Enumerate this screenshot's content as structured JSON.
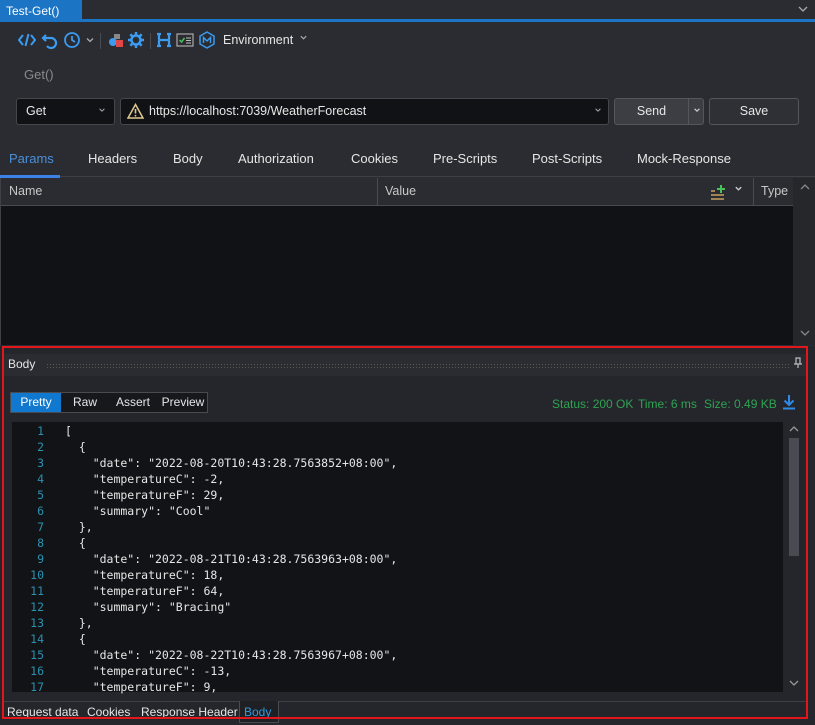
{
  "document_tab": {
    "title": "Test-Get()",
    "close_icon": "close-icon"
  },
  "toolbar": {
    "icons": [
      "code-icon",
      "undo-icon",
      "history-icon",
      "chevron-down-icon",
      "plugin-icon",
      "gear-icon",
      "header-icon",
      "checklist-icon",
      "mock-icon"
    ],
    "environment_label": "Environment"
  },
  "request": {
    "name": "Get()",
    "method": "Get",
    "url": "https://localhost:7039/WeatherForecast",
    "send_label": "Send",
    "save_label": "Save"
  },
  "request_tabs": [
    {
      "label": "Params",
      "active": true
    },
    {
      "label": "Headers"
    },
    {
      "label": "Body"
    },
    {
      "label": "Authorization"
    },
    {
      "label": "Cookies"
    },
    {
      "label": "Pre-Scripts"
    },
    {
      "label": "Post-Scripts"
    },
    {
      "label": "Mock-Response"
    }
  ],
  "params_grid": {
    "columns": [
      "Name",
      "Value",
      "Type"
    ],
    "rows": []
  },
  "response": {
    "panel_title": "Body",
    "view_tabs": [
      {
        "label": "Pretty",
        "active": true
      },
      {
        "label": "Raw"
      },
      {
        "label": "Assert"
      },
      {
        "label": "Preview"
      }
    ],
    "status": "Status: 200 OK",
    "time": "Time: 6 ms",
    "size": "Size: 0.49 KB",
    "code_lines": [
      "[",
      "  {",
      "    \"date\": \"2022-08-20T10:43:28.7563852+08:00\",",
      "    \"temperatureC\": -2,",
      "    \"temperatureF\": 29,",
      "    \"summary\": \"Cool\"",
      "  },",
      "  {",
      "    \"date\": \"2022-08-21T10:43:28.7563963+08:00\",",
      "    \"temperatureC\": 18,",
      "    \"temperatureF\": 64,",
      "    \"summary\": \"Bracing\"",
      "  },",
      "  {",
      "    \"date\": \"2022-08-22T10:43:28.7563967+08:00\",",
      "    \"temperatureC\": -13,",
      "    \"temperatureF\": 9,"
    ],
    "bottom_tabs": [
      {
        "label": "Request data"
      },
      {
        "label": "Cookies"
      },
      {
        "label": "Response Header"
      },
      {
        "label": "Body",
        "active": true
      }
    ]
  },
  "colors": {
    "accent": "#1c74c4",
    "status_green": "#2ea353",
    "highlight_border": "#e3161b",
    "line_number": "#2b91af"
  }
}
